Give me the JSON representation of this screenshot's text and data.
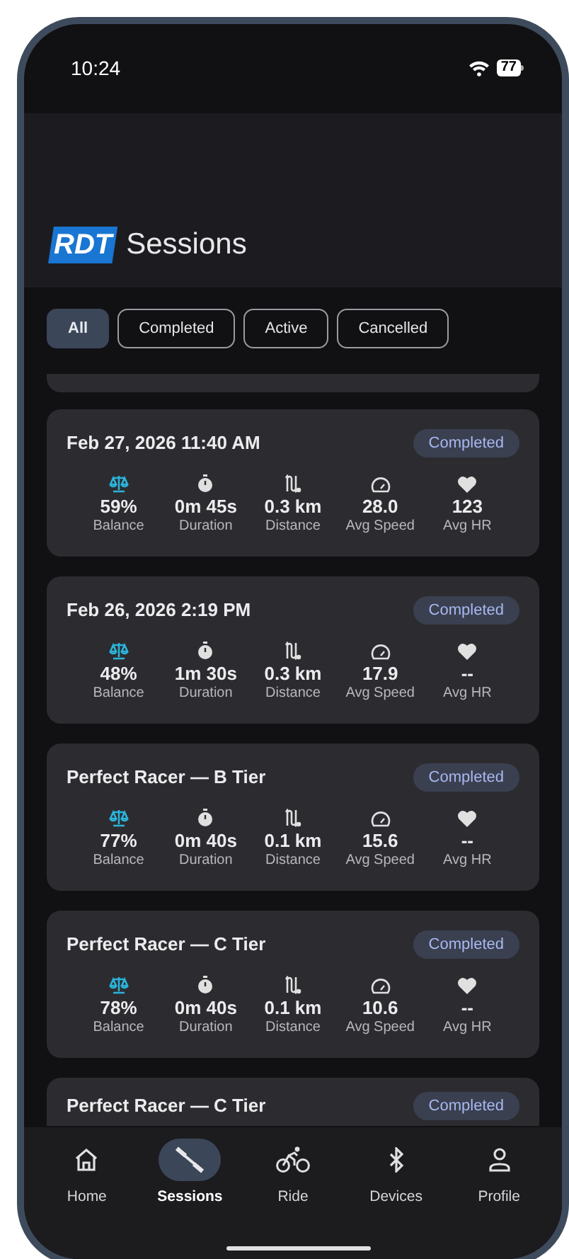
{
  "status_bar": {
    "time": "10:24",
    "battery": "77"
  },
  "header": {
    "logo": "RDT",
    "title": "Sessions"
  },
  "filters": [
    {
      "label": "All",
      "selected": true
    },
    {
      "label": "Completed",
      "selected": false
    },
    {
      "label": "Active",
      "selected": false
    },
    {
      "label": "Cancelled",
      "selected": false
    }
  ],
  "sessions": [
    {
      "title": "Feb 27, 2026 11:40 AM",
      "status": "Completed",
      "metrics": [
        {
          "kind": "balance",
          "value": "59%",
          "label": "Balance"
        },
        {
          "kind": "duration",
          "value": "0m 45s",
          "label": "Duration"
        },
        {
          "kind": "distance",
          "value": "0.3 km",
          "label": "Distance"
        },
        {
          "kind": "speed",
          "value": "28.0",
          "label": "Avg Speed"
        },
        {
          "kind": "heart",
          "value": "123",
          "label": "Avg HR"
        }
      ]
    },
    {
      "title": "Feb 26, 2026 2:19 PM",
      "status": "Completed",
      "metrics": [
        {
          "kind": "balance",
          "value": "48%",
          "label": "Balance"
        },
        {
          "kind": "duration",
          "value": "1m 30s",
          "label": "Duration"
        },
        {
          "kind": "distance",
          "value": "0.3 km",
          "label": "Distance"
        },
        {
          "kind": "speed",
          "value": "17.9",
          "label": "Avg Speed"
        },
        {
          "kind": "heart",
          "value": "--",
          "label": "Avg HR"
        }
      ]
    },
    {
      "title": "Perfect Racer — B Tier",
      "status": "Completed",
      "metrics": [
        {
          "kind": "balance",
          "value": "77%",
          "label": "Balance"
        },
        {
          "kind": "duration",
          "value": "0m 40s",
          "label": "Duration"
        },
        {
          "kind": "distance",
          "value": "0.1 km",
          "label": "Distance"
        },
        {
          "kind": "speed",
          "value": "15.6",
          "label": "Avg Speed"
        },
        {
          "kind": "heart",
          "value": "--",
          "label": "Avg HR"
        }
      ]
    },
    {
      "title": "Perfect Racer — C Tier",
      "status": "Completed",
      "metrics": [
        {
          "kind": "balance",
          "value": "78%",
          "label": "Balance"
        },
        {
          "kind": "duration",
          "value": "0m 40s",
          "label": "Duration"
        },
        {
          "kind": "distance",
          "value": "0.1 km",
          "label": "Distance"
        },
        {
          "kind": "speed",
          "value": "10.6",
          "label": "Avg Speed"
        },
        {
          "kind": "heart",
          "value": "--",
          "label": "Avg HR"
        }
      ]
    },
    {
      "title": "Perfect Racer — C Tier",
      "status": "Completed"
    }
  ],
  "nav": [
    {
      "kind": "home",
      "label": "Home",
      "selected": false
    },
    {
      "kind": "sessions",
      "label": "Sessions",
      "selected": true
    },
    {
      "kind": "ride",
      "label": "Ride",
      "selected": false
    },
    {
      "kind": "devices",
      "label": "Devices",
      "selected": false
    },
    {
      "kind": "profile",
      "label": "Profile",
      "selected": false
    }
  ]
}
